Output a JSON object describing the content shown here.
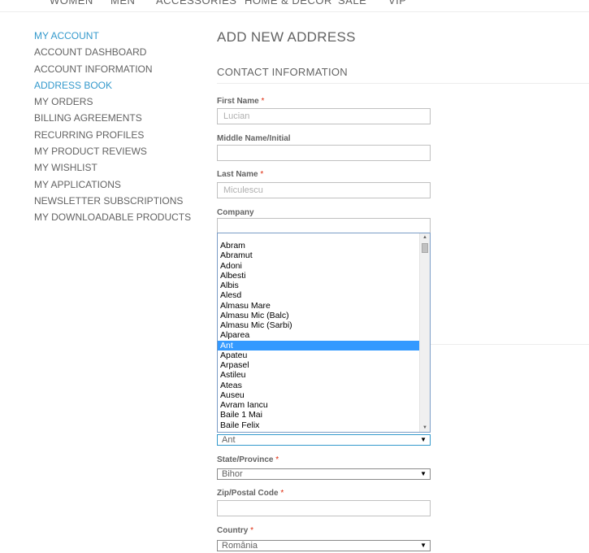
{
  "topnav": {
    "items": [
      "WOMEN",
      "MEN",
      "ACCESSORIES",
      "HOME & DECOR",
      "SALE",
      "VIP"
    ]
  },
  "sidebar": {
    "heading": "MY ACCOUNT",
    "items": [
      {
        "label": "ACCOUNT DASHBOARD"
      },
      {
        "label": "ACCOUNT INFORMATION"
      },
      {
        "label": "ADDRESS BOOK",
        "active": true
      },
      {
        "label": "MY ORDERS"
      },
      {
        "label": "BILLING AGREEMENTS"
      },
      {
        "label": "RECURRING PROFILES"
      },
      {
        "label": "MY PRODUCT REVIEWS"
      },
      {
        "label": "MY WISHLIST"
      },
      {
        "label": "MY APPLICATIONS"
      },
      {
        "label": "NEWSLETTER SUBSCRIPTIONS"
      },
      {
        "label": "MY DOWNLOADABLE PRODUCTS"
      }
    ]
  },
  "main": {
    "title": "ADD NEW ADDRESS",
    "section": "CONTACT INFORMATION",
    "required_mark": "*",
    "first_name": {
      "label": "First Name",
      "value": "Lucian"
    },
    "middle_name": {
      "label": "Middle Name/Initial",
      "value": ""
    },
    "last_name": {
      "label": "Last Name",
      "value": "Miculescu"
    },
    "company": {
      "label": "Company",
      "value": ""
    },
    "city_select": {
      "value": "Ant",
      "options": [
        "Abram",
        "Abramut",
        "Adoni",
        "Albesti",
        "Albis",
        "Alesd",
        "Almasu Mare",
        "Almasu Mic (Balc)",
        "Almasu Mic (Sarbi)",
        "Alparea",
        "Ant",
        "Apateu",
        "Arpasel",
        "Astileu",
        "Ateas",
        "Auseu",
        "Avram Iancu",
        "Baile 1 Mai",
        "Baile Felix"
      ],
      "selected_index": 10
    },
    "state": {
      "label": "State/Province",
      "value": "Bihor"
    },
    "zip": {
      "label": "Zip/Postal Code",
      "value": ""
    },
    "country": {
      "label": "Country",
      "value": "România"
    }
  },
  "icons": {
    "dropdown_arrow": "triangle-down",
    "scroll_up": "triangle-up",
    "scroll_down": "triangle-down"
  },
  "colors": {
    "accent": "#3399cc",
    "required": "#df280a",
    "selection": "#3399ff"
  }
}
